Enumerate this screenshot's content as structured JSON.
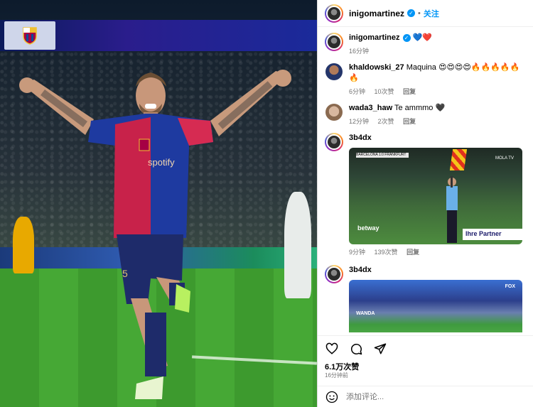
{
  "post": {
    "author": "inigomartinez",
    "verified": true,
    "follow_label": "关注",
    "separator": "•",
    "caption_emojis": "💙❤️",
    "caption_time": "16分钟",
    "likes": "6.1万次赞",
    "posted_ago": "16分钟前",
    "add_comment_placeholder": "添加评论..."
  },
  "photo": {
    "shirt_text": "spotify",
    "shirt_number": "5"
  },
  "comments": [
    {
      "user": "khaldowski_27",
      "text": "Maquina 😍😍😍😍🔥🔥🔥🔥🔥🔥",
      "time": "6分钟",
      "likes": "10次赞",
      "reply": "回复"
    },
    {
      "user": "wada3_haw",
      "text": "Te ammmo 🖤",
      "time": "12分钟",
      "likes": "2次赞",
      "reply": "回复"
    },
    {
      "user": "3b4dx",
      "text": "",
      "time": "9分钟",
      "likes": "139次赞",
      "reply": "回复",
      "media": {
        "brand_left": "betway",
        "brand_right": "Ihre Partner",
        "tv": "MOLA TV",
        "score": "BARCELONA 1:0 FRANKFURT"
      }
    },
    {
      "user": "3b4dx",
      "text": "",
      "media": {
        "tv": "FOX",
        "ad": "WANDA"
      }
    }
  ],
  "colors": {
    "accent": "#0095f6",
    "meta": "#737373",
    "border": "#dbdbdb"
  },
  "icons": [
    "heart-icon",
    "comment-icon",
    "share-icon",
    "emoji-icon"
  ]
}
